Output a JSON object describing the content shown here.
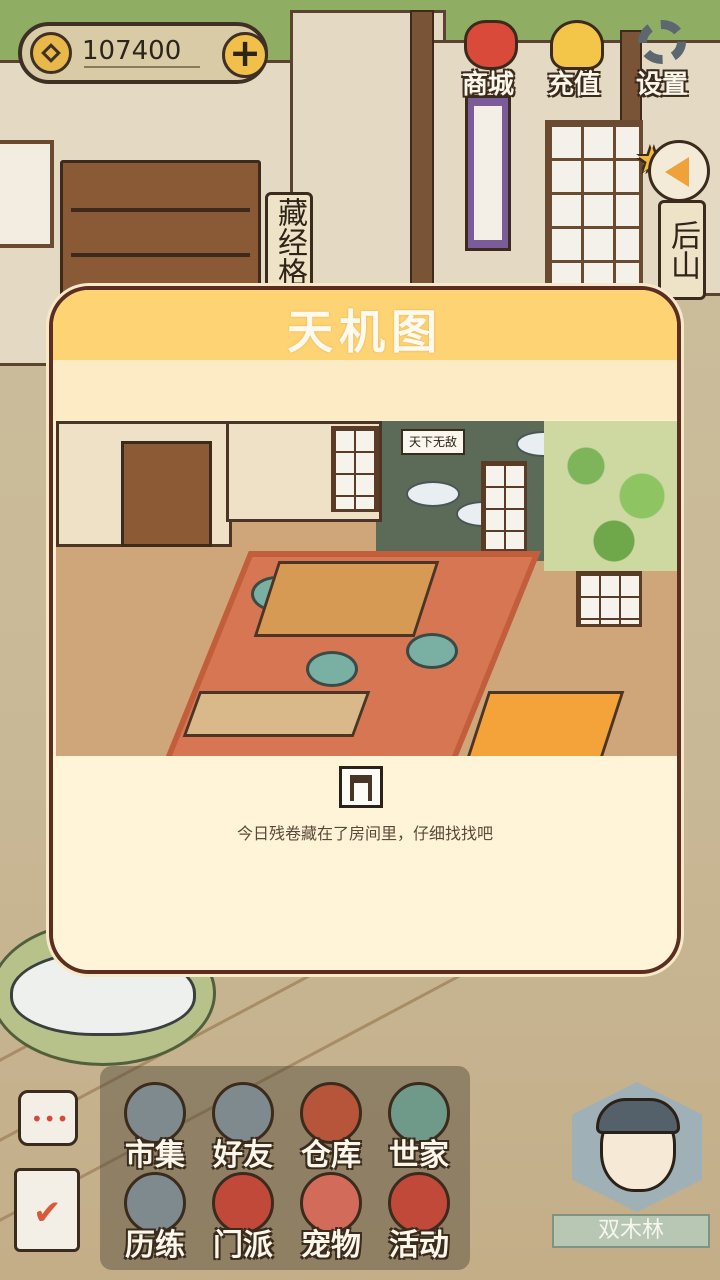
{
  "hud": {
    "coins": "107400",
    "top_buttons": [
      {
        "label": "商城",
        "icon": "shop-bag-icon"
      },
      {
        "label": "充值",
        "icon": "gold-ingot-icon"
      },
      {
        "label": "设置",
        "icon": "gear-icon"
      }
    ],
    "back_mountain": "后山",
    "library_sign": "藏经格"
  },
  "dialog": {
    "title": "天机图",
    "room_sign": "天下无敌",
    "hint": "今日残卷藏在了房间里，仔细找找吧"
  },
  "menu": [
    {
      "label": "市集",
      "color": "#7f8a8f"
    },
    {
      "label": "好友",
      "color": "#7f8a8f"
    },
    {
      "label": "仓库",
      "color": "#b6553a"
    },
    {
      "label": "世家",
      "color": "#6f9a8a"
    },
    {
      "label": "历练",
      "color": "#7f8a8f"
    },
    {
      "label": "门派",
      "color": "#c0493a"
    },
    {
      "label": "宠物",
      "color": "#d36b5a"
    },
    {
      "label": "活动",
      "color": "#c0493a"
    }
  ],
  "side": {
    "chat_dots": "•••",
    "task_check": "✔"
  },
  "player": {
    "name": "双木林"
  }
}
